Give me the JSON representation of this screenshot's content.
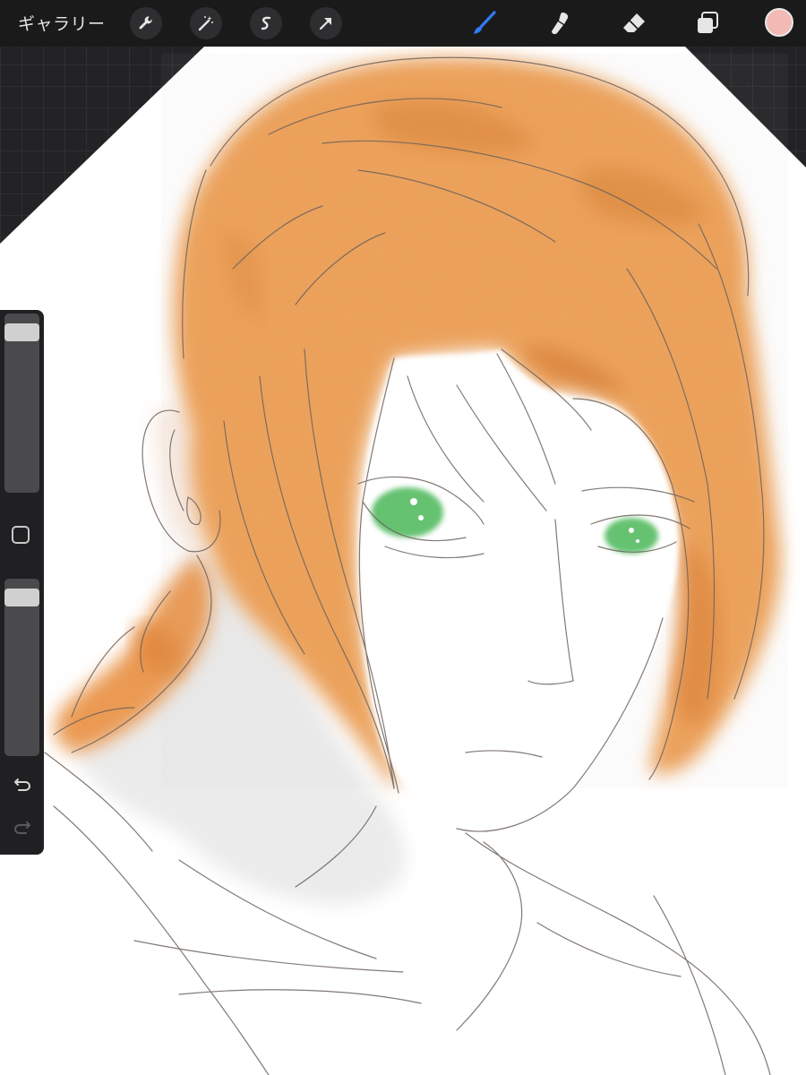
{
  "toolbar": {
    "gallery_label": "ギャラリー",
    "left_tools": [
      "wrench-icon",
      "magic-wand-icon",
      "selection-s-icon",
      "transform-arrow-icon"
    ],
    "right_tools": [
      "brush-icon",
      "smudge-icon",
      "eraser-icon",
      "layers-icon"
    ],
    "active_tool": "brush",
    "current_color": "#f2b9b5"
  },
  "sidebar": {
    "brush_size_level": 0.05,
    "opacity_level": 0.05,
    "icons": [
      "modify-square-icon",
      "undo-icon",
      "redo-icon"
    ]
  },
  "colors": {
    "accent_active": "#2f7bf6",
    "hair": "#e8934a",
    "eyes": "#5dbf6a"
  }
}
